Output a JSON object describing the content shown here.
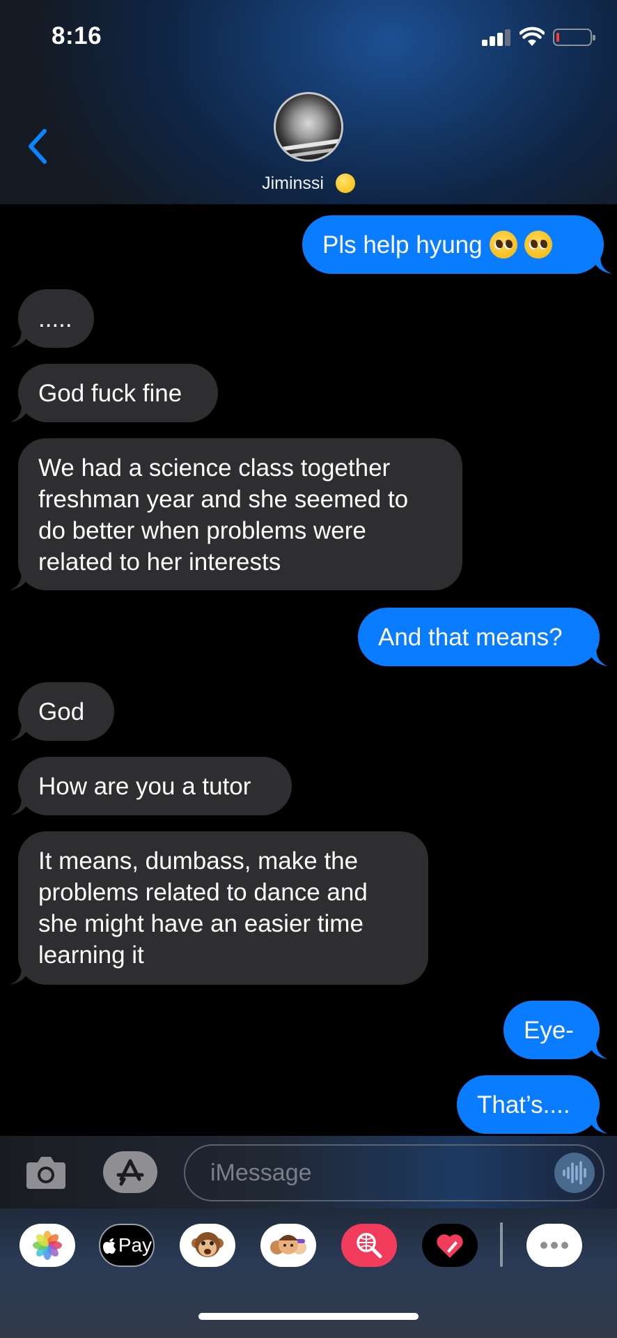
{
  "status_bar": {
    "time": "8:16"
  },
  "contact": {
    "name": "Jiminssi"
  },
  "messages": [
    {
      "direction": "out",
      "text": "Pls help hyung"
    },
    {
      "direction": "in",
      "text": "....."
    },
    {
      "direction": "in",
      "text": "God fuck fine"
    },
    {
      "direction": "in",
      "lines": [
        "We had a science class together",
        "freshman year and she seemed to",
        "do better when problems were",
        "related to her interests"
      ]
    },
    {
      "direction": "out",
      "text": "And that means?"
    },
    {
      "direction": "in",
      "text": "God"
    },
    {
      "direction": "in",
      "text": "How are you a tutor"
    },
    {
      "direction": "in",
      "lines": [
        "It means, dumbass, make the",
        "problems related to dance and",
        "she might have an easier time",
        "learning it"
      ]
    },
    {
      "direction": "out",
      "text": "Eye-"
    },
    {
      "direction": "out",
      "text": "That’s...."
    }
  ],
  "input": {
    "placeholder": "iMessage"
  },
  "app_drawer": {
    "apple_pay_label": "Pay",
    "apps": [
      "photos-icon",
      "apple-pay-icon",
      "animoji-icon",
      "memoji-icon",
      "web-search-icon",
      "digital-touch-icon",
      "more-icon"
    ]
  },
  "colors": {
    "outgoing_bubble": "#0a7cff",
    "incoming_bubble": "#2e2e30",
    "accent": "#0a84ff"
  }
}
